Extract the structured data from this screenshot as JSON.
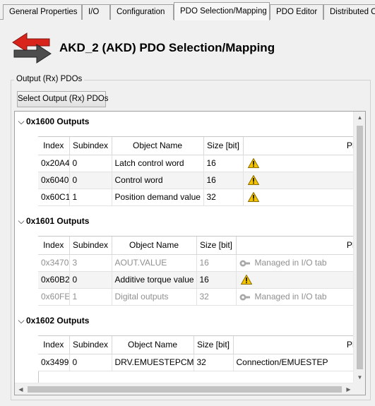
{
  "tabs": [
    {
      "label": "General Properties"
    },
    {
      "label": "I/O"
    },
    {
      "label": "Configuration"
    },
    {
      "label": "PDO Selection/Mapping",
      "active": true
    },
    {
      "label": "PDO Editor"
    },
    {
      "label": "Distributed C"
    }
  ],
  "header": {
    "title": "AKD_2 (AKD) PDO Selection/Mapping",
    "icon": "pdo-mapping-arrows-icon"
  },
  "group": {
    "label": "Output (Rx) PDOs",
    "select_button": "Select Output (Rx) PDOs"
  },
  "columns": {
    "index": "Index",
    "subindex": "Subindex",
    "name": "Object Name",
    "size": "Size [bit]",
    "plc": "PLC V"
  },
  "sections": [
    {
      "title": "0x1600 Outputs",
      "rows": [
        {
          "index": "0x20A4",
          "subindex": "0",
          "name": "Latch control word",
          "size": "16",
          "plc": "",
          "plc_icon": "warning-icon"
        },
        {
          "index": "0x6040",
          "subindex": "0",
          "name": "Control word",
          "size": "16",
          "plc": "",
          "plc_icon": "warning-icon"
        },
        {
          "index": "0x60C1",
          "subindex": "1",
          "name": "Position demand value",
          "size": "32",
          "plc": "",
          "plc_icon": "warning-icon"
        }
      ]
    },
    {
      "title": "0x1601 Outputs",
      "rows": [
        {
          "index": "0x3470",
          "subindex": "3",
          "name": "AOUT.VALUE",
          "size": "16",
          "plc": "Managed in I/O tab",
          "plc_icon": "managed-icon",
          "dim": true
        },
        {
          "index": "0x60B2",
          "subindex": "0",
          "name": "Additive torque value",
          "size": "16",
          "plc": "",
          "plc_icon": "warning-icon"
        },
        {
          "index": "0x60FE",
          "subindex": "1",
          "name": "Digital outputs",
          "size": "32",
          "plc": "Managed in I/O tab",
          "plc_icon": "managed-icon",
          "dim": true
        }
      ]
    },
    {
      "title": "0x1602 Outputs",
      "rows": [
        {
          "index": "0x3499",
          "subindex": "0",
          "name": "DRV.EMUESTEPCMD",
          "size": "32",
          "plc": "Connection/EMUESTEP",
          "plc_icon": ""
        }
      ]
    }
  ],
  "colors": {
    "accent_red": "#d9241c",
    "warning_yellow": "#f5c400",
    "tab_border": "#a0a0a0"
  }
}
